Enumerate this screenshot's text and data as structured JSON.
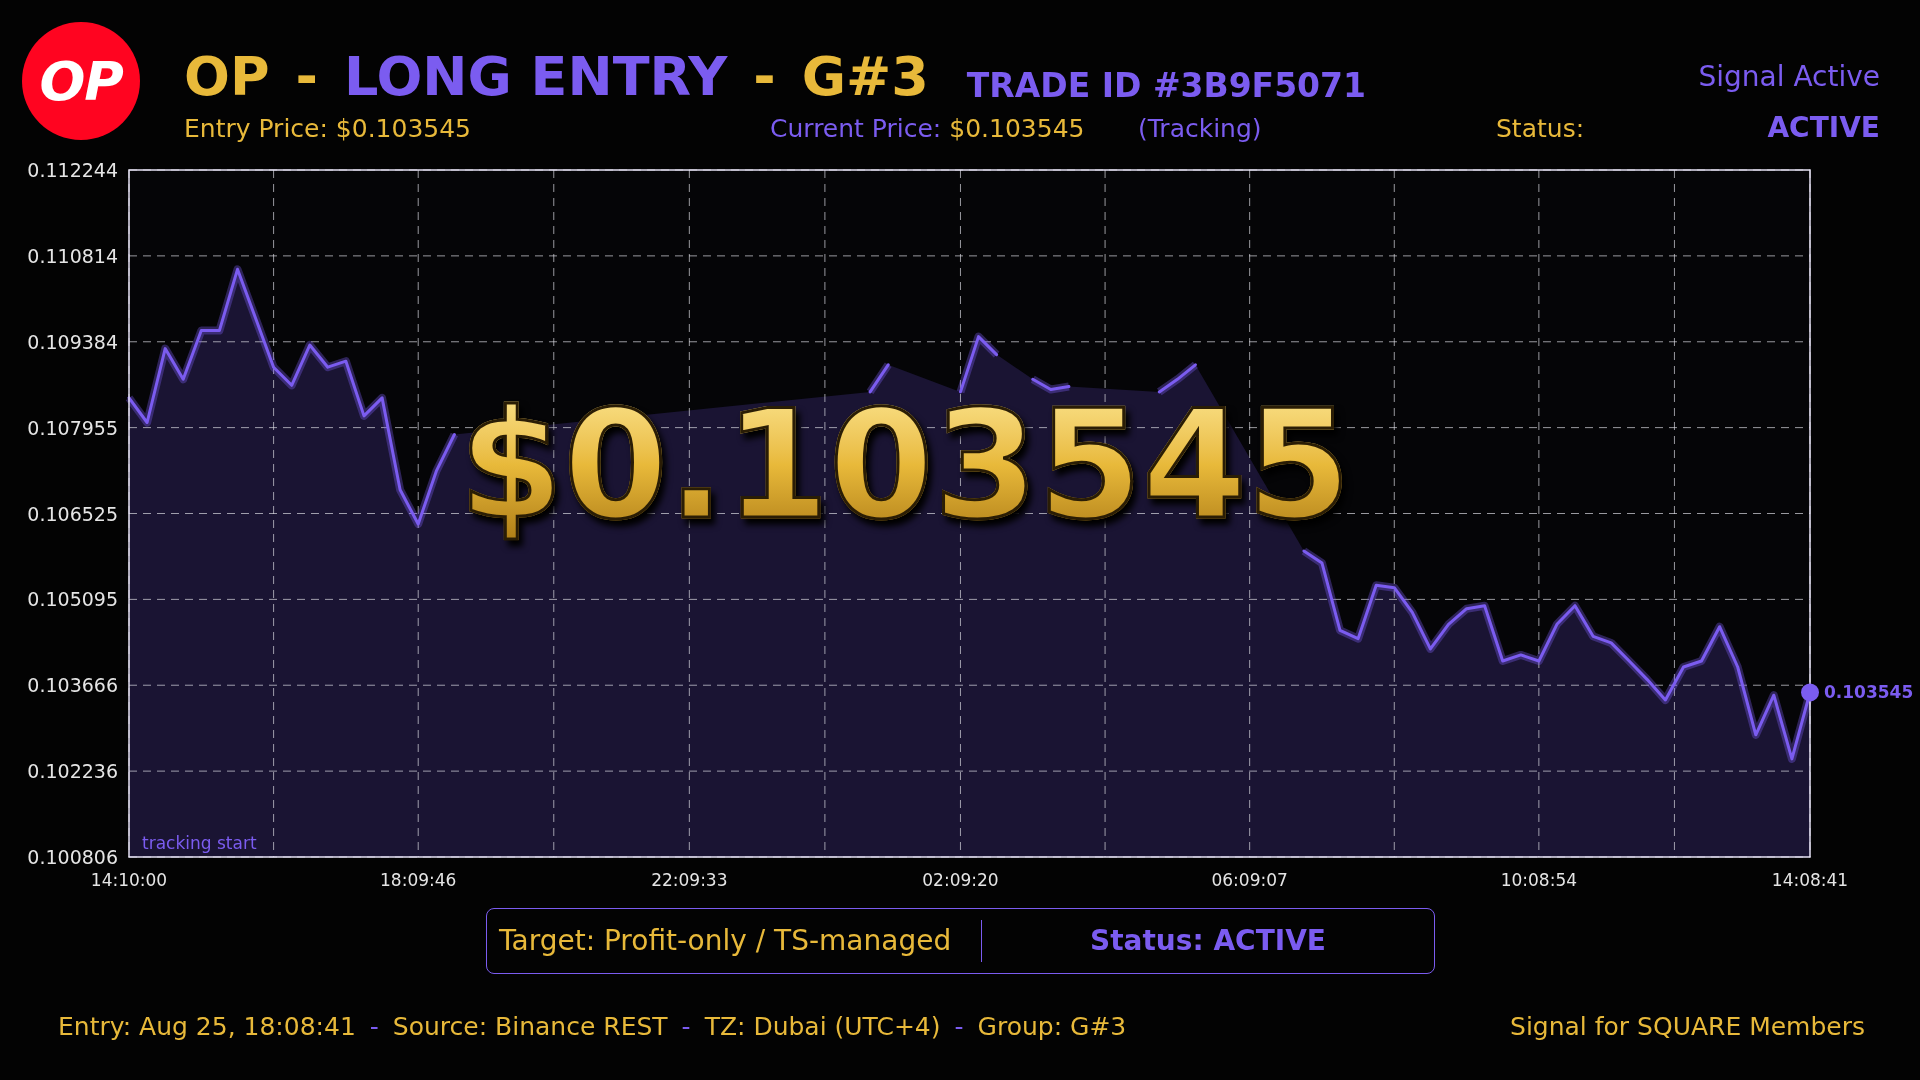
{
  "header": {
    "logo": "OP",
    "title": [
      {
        "text": "OP",
        "color": "#e8b93a"
      },
      {
        "text": "-",
        "color": "#e8b93a"
      },
      {
        "text": "LONG ENTRY",
        "color": "#7b5cf0"
      },
      {
        "text": "-",
        "color": "#e8b93a"
      },
      {
        "text": "G#3",
        "color": "#e8b93a"
      }
    ],
    "trade_id": "TRADE ID #3B9F5071",
    "signal": "Signal Active",
    "entry_price": "Entry Price: $0.103545",
    "current_price_label": "Current Price:",
    "current_price": "$0.103545",
    "tracking": "(Tracking)",
    "status_label": "Status:",
    "status_value": "ACTIVE"
  },
  "chart": {
    "big_price": "$0.103545",
    "start_label": "tracking start",
    "end_label": "0.103545",
    "chart_data": {
      "type": "line",
      "grid": true,
      "ylim": [
        0.100806,
        0.112244
      ],
      "yticks": [
        0.100806,
        0.102236,
        0.103666,
        0.105095,
        0.106525,
        0.107955,
        0.109384,
        0.110814,
        0.112244
      ],
      "categories": [
        "14:10:00",
        null,
        null,
        null,
        null,
        null,
        null,
        null,
        null,
        null,
        null,
        null,
        null,
        null,
        null,
        null,
        "18:09:46",
        null,
        null,
        null,
        null,
        null,
        null,
        null,
        null,
        null,
        null,
        null,
        null,
        null,
        null,
        "22:09:33",
        null,
        null,
        null,
        null,
        null,
        null,
        null,
        null,
        null,
        null,
        null,
        null,
        null,
        null,
        "02:09:20",
        null,
        null,
        null,
        null,
        null,
        null,
        null,
        null,
        null,
        null,
        null,
        null,
        null,
        null,
        null,
        "06:09:07",
        null,
        null,
        null,
        null,
        null,
        null,
        null,
        null,
        null,
        null,
        null,
        null,
        null,
        null,
        null,
        "10:08:54",
        null,
        null,
        null,
        null,
        null,
        null,
        null,
        null,
        null,
        null,
        null,
        null,
        null,
        null,
        "14:08:41"
      ],
      "series": [
        {
          "color": "#7b5cf0",
          "values": [
            0.10845,
            0.10804,
            0.10927,
            0.10876,
            0.10957,
            0.10957,
            0.11059,
            0.10978,
            0.10896,
            0.10866,
            0.10933,
            0.10896,
            0.10906,
            0.10815,
            0.10845,
            0.10692,
            0.10635,
            0.10723,
            0.10784,
            null,
            null,
            null,
            null,
            null,
            null,
            null,
            null,
            null,
            null,
            null,
            null,
            null,
            null,
            null,
            null,
            null,
            null,
            null,
            null,
            null,
            null,
            0.10855,
            0.109,
            null,
            null,
            null,
            0.10855,
            0.10947,
            0.10917,
            null,
            0.10876,
            0.10859,
            0.10864,
            null,
            null,
            null,
            null,
            0.10855,
            0.10876,
            0.109,
            null,
            null,
            null,
            null,
            null,
            0.1059,
            0.1057,
            0.10458,
            0.10444,
            0.10533,
            0.10529,
            0.10488,
            0.10427,
            0.10468,
            0.10494,
            0.10499,
            0.10407,
            0.10417,
            0.10407,
            0.10468,
            0.10499,
            0.10448,
            0.10437,
            0.10407,
            0.10376,
            0.10342,
            0.10397,
            0.10407,
            0.10464,
            0.10397,
            0.10284,
            0.1035,
            0.10244,
            0.103545
          ]
        }
      ]
    }
  },
  "target_box": {
    "target": "Target: Profit-only / TS-managed",
    "status": "Status: ACTIVE"
  },
  "footer": {
    "parts": [
      {
        "text": "Entry: Aug 25, 18:08:41",
        "kind": "value"
      },
      {
        "text": "-",
        "kind": "separator"
      },
      {
        "text": "Source: Binance REST",
        "kind": "value"
      },
      {
        "text": "-",
        "kind": "separator"
      },
      {
        "text": "TZ: Dubai (UTC+4)",
        "kind": "value"
      },
      {
        "text": "-",
        "kind": "separator"
      },
      {
        "text": "Group: G#3",
        "kind": "value"
      }
    ],
    "tagline": "Signal for SQUARE Members"
  }
}
